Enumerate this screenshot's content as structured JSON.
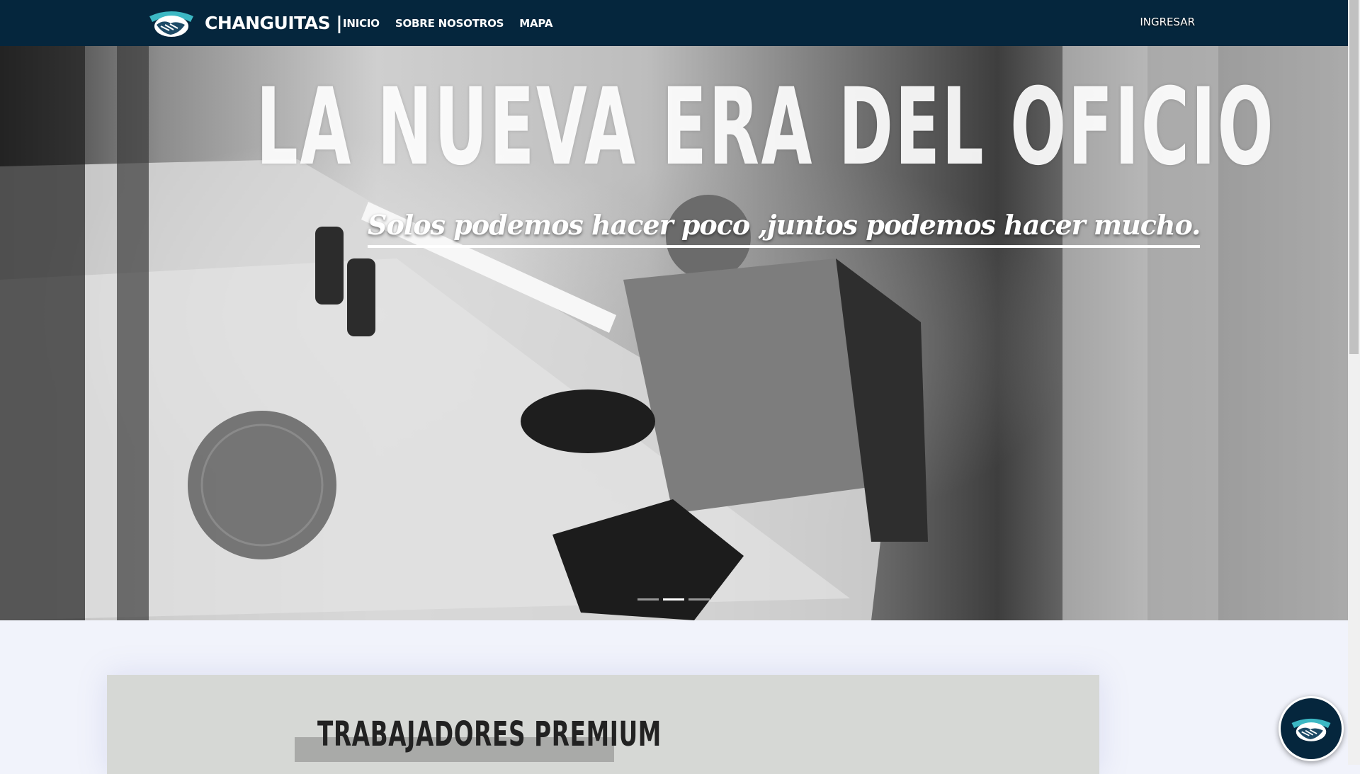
{
  "brand": {
    "name": "CHANGUITAS |",
    "logo_icon": "handshake-icon"
  },
  "nav": {
    "items": [
      {
        "label": "INICIO"
      },
      {
        "label": "SOBRE NOSOTROS"
      },
      {
        "label": "MAPA"
      }
    ],
    "login_label": "INGRESAR"
  },
  "hero": {
    "title": "LA NUEVA ERA DEL OFICIO",
    "subtitle": "Solos podemos hacer poco ,juntos podemos hacer mucho.",
    "slides": 3,
    "active_slide": 2
  },
  "premium": {
    "title": "TRABAJADORES PREMIUM"
  },
  "chat": {
    "icon": "handshake-icon"
  },
  "colors": {
    "navbar": "#05263d",
    "accent": "#3cb8c4"
  }
}
